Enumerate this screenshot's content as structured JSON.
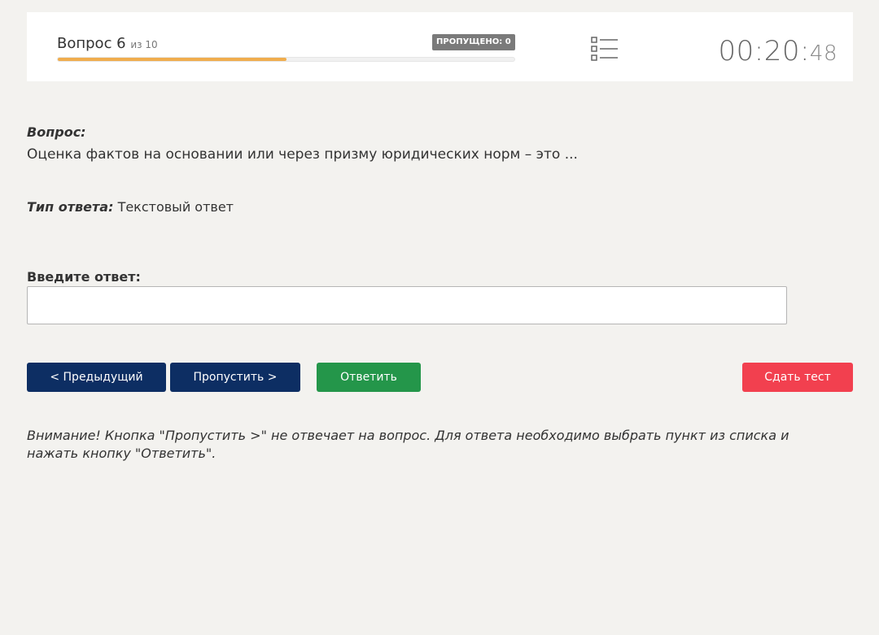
{
  "header": {
    "question_label": "Вопрос 6",
    "question_of": "из 10",
    "skipped_badge": "ПРОПУЩЕНО: 0",
    "progress_fraction": 0.5,
    "list_icon": "list-icon",
    "timer_main": "00:20:",
    "timer_seconds": "48"
  },
  "question": {
    "label": "Вопрос:",
    "text": "Оценка фактов на основании или через призму юридических норм – это ..."
  },
  "answer_type": {
    "label": "Тип ответа:",
    "value": "Текстовый ответ"
  },
  "answer_input": {
    "label": "Введите ответ:",
    "value": "",
    "placeholder": ""
  },
  "buttons": {
    "prev": "< Предыдущий",
    "skip": "Пропустить >",
    "answer": "Ответить",
    "submit": "Сдать тест"
  },
  "notice": "Внимание! Кнопка \"Пропустить >\" не отвечает на вопрос. Для ответа необходимо выбрать пункт из списка и нажать кнопку \"Ответить\".",
  "colors": {
    "primary": "#0d2e63",
    "success": "#24964a",
    "danger": "#f2404f",
    "progress": "#f0ad4e",
    "badge": "#7a7a7a"
  }
}
